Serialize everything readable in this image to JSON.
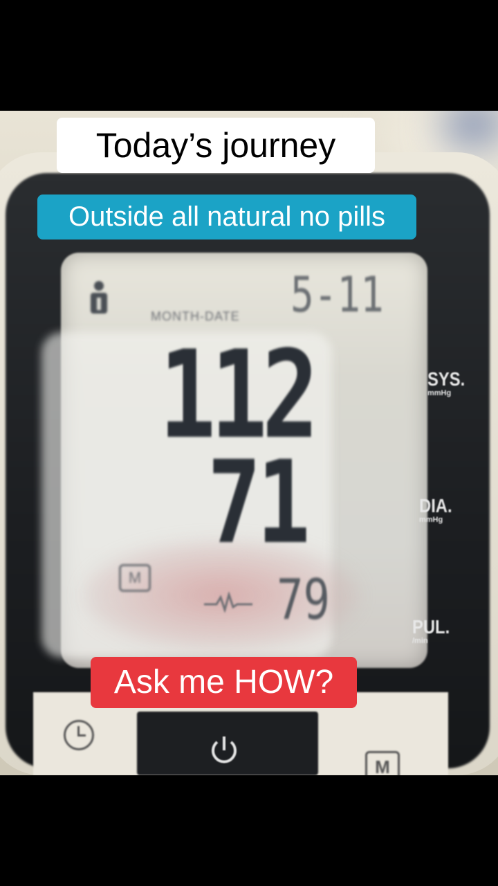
{
  "captions": {
    "title": "Today’s journey",
    "subtitle": "Outside all natural no pills",
    "cta": "Ask me HOW?"
  },
  "monitor": {
    "month_date_label": "MONTH-DATE",
    "date": "5-11",
    "systolic": "112",
    "diastolic": "71",
    "pulse": "79",
    "sys_label": "SYS.",
    "sys_unit": "mmHg",
    "dia_label": "DIA.",
    "dia_unit": "mmHg",
    "pul_label": "PUL.",
    "pul_unit": "/min",
    "memory_icon_text": "M",
    "button_m_text": "M"
  },
  "icons": [
    "user-icon",
    "memory-icon",
    "heartbeat-icon",
    "clock-icon",
    "power-icon"
  ],
  "colors": {
    "title_bg": "#ffffff",
    "subtitle_bg": "#1ba3c6",
    "cta_bg": "#e8383e"
  }
}
